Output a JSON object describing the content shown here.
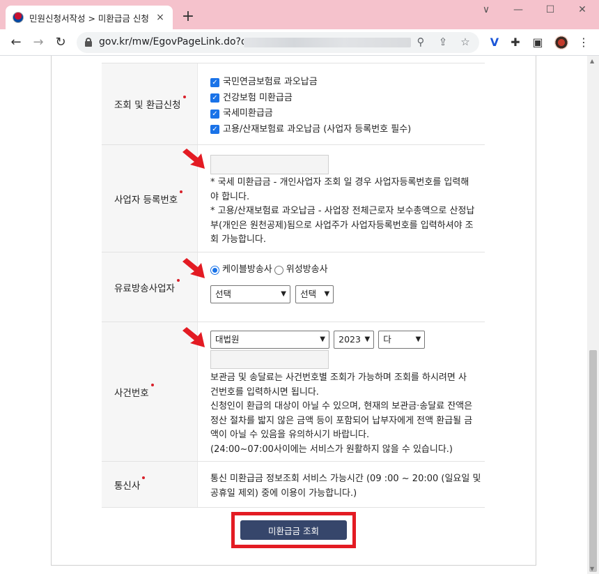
{
  "browser": {
    "tab_title": "민원신청서작성 > 미환급금 신청",
    "tab_close": "×",
    "new_tab": "+",
    "window_controls": {
      "chevron": "∨",
      "minimize": "—",
      "maximize": "☐",
      "close": "✕"
    },
    "url": "gov.kr/mw/EgovPageLink.do?q=",
    "icons": [
      "back-arrow-icon",
      "forward-arrow-icon",
      "reload-icon",
      "lock-icon",
      "zoom-icon",
      "share-icon",
      "star-icon",
      "vpn-extension-icon",
      "puzzle-icon",
      "side-panel-icon",
      "profile-avatar",
      "menu-icon"
    ]
  },
  "form": {
    "refund_request": {
      "label": "조회 및 환급신청",
      "options": [
        {
          "label": "국민연금보험료 과오납금",
          "checked": true
        },
        {
          "label": "건강보험 미환급금",
          "checked": true
        },
        {
          "label": "국세미환급금",
          "checked": true
        },
        {
          "label": "고용/산재보험료 과오납금 (사업자 등록번호 필수)",
          "checked": true
        }
      ]
    },
    "business_number": {
      "label": "사업자 등록번호",
      "input_value": "",
      "notes": [
        "* 국세 미환급금 - 개인사업자 조회 일 경우 사업자등록번호를 입력해",
        "야 합니다.",
        "* 고용/산재보험료 과오납금 - 사업장 전체근로자 보수총액으로 산정납",
        "부(개인은 원천공제)됨으로 사업주가 사업자등록번호를 입력하셔야 조",
        "회 가능합니다."
      ]
    },
    "broadcaster": {
      "label": "유료방송사업자",
      "radio_options": [
        {
          "label": "케이블방송사",
          "selected": true
        },
        {
          "label": "위성방송사",
          "selected": false
        }
      ],
      "select_1": "선택",
      "select_2": "선택"
    },
    "case_number": {
      "label": "사건번호",
      "court_select": "대법원",
      "year_select": "2023",
      "type_select": "다",
      "input_value": "",
      "notes": [
        "보관금 및 송달료는 사건번호별 조회가 가능하며 조회를 하시려면 사",
        "건번호를 입력하시면 됩니다.",
        "신청인이 환급의 대상이 아닐 수 있으며, 현재의 보관금·송달료 잔액은",
        "정산 절차를 밟지 않은 금액 등이 포함되어 납부자에게 전액 환급될 금",
        "액이 아닐 수 있음을 유의하시기 바랍니다.",
        "(24:00~07:00사이에는 서비스가 원활하지 않을 수 있습니다.)"
      ]
    },
    "telecom": {
      "label": "통신사",
      "notes": [
        "통신 미환급금 정보조회 서비스 가능시간 (09 :00 ~ 20:00 (일요일 및",
        "공휴일 제외) 중에 이용이 가능합니다.)"
      ]
    },
    "submit_label": "미환급금 조회"
  },
  "annotation_colors": {
    "arrow": "#e31b23",
    "frame": "#e31b23",
    "button": "#36466b",
    "required_dot": "#d8202a"
  }
}
